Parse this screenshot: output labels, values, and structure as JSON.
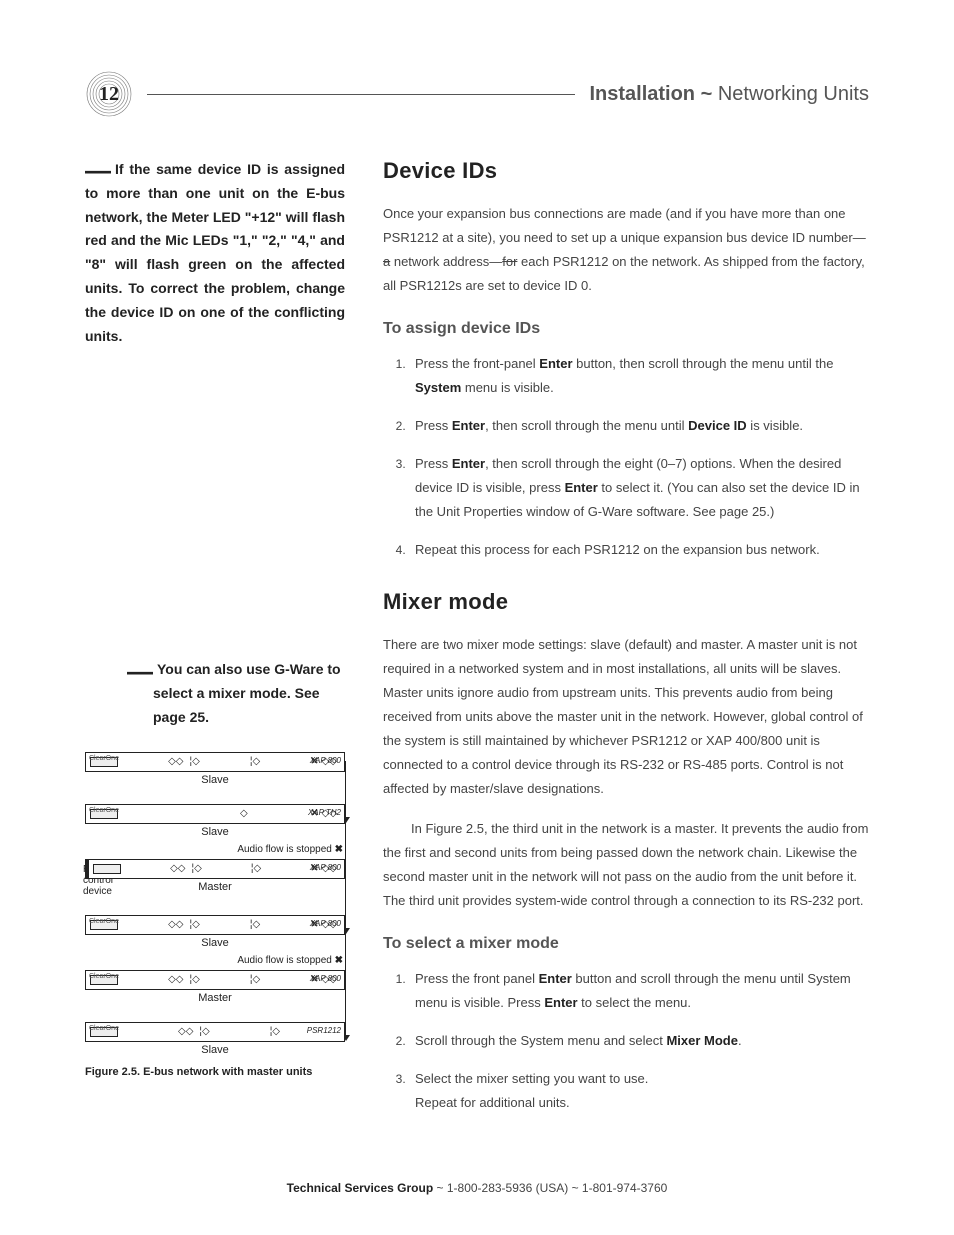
{
  "page_number": "12",
  "header": {
    "strong": "Installation",
    "sep": " ~ ",
    "light": "Networking Units"
  },
  "sidenote1": {
    "lead": "If the same device ID is assigned to more than one unit on the E-bus network, the Meter LED \"+12\" will flash red and the Mic LEDs \"1,\" \"2,\" \"4,\" and \"8\" will flash green on the affected units. To correct the problem, change the device ID on one of the conflicting units."
  },
  "sidenote2": {
    "text": "You can also use G-Ware to select a mixer mode. See page 25."
  },
  "figure": {
    "caption": "Figure 2.5. E-bus network with master units",
    "units": [
      "Slave",
      "Slave",
      "Master",
      "Slave",
      "Master",
      "Slave"
    ],
    "stop_msg": "Audio flow is stopped",
    "rs_label": "RS-232 control device",
    "last_brand": "PSR1212"
  },
  "main": {
    "h1a": "Device IDs",
    "p1_a": "Once your expansion bus connections are made (and if you have more than one PSR1212 at a site), you need to set up a unique expansion bus device ID number—",
    "p1_strike1": "a",
    "p1_b": " network address—",
    "p1_strike2": "for",
    "p1_c": " each PSR1212 on the network. As shipped from the factory, all PSR1212s are set to device ID 0.",
    "h2a": "To assign device IDs",
    "stepsA": [
      {
        "pre": "Press the front-panel ",
        "b1": "Enter",
        "mid": " button, then scroll through the menu until the ",
        "b2": "System",
        "post": " menu is visible."
      },
      {
        "pre": "Press ",
        "b1": "Enter",
        "mid": ", then scroll through the menu until ",
        "b2": "Device ID",
        "post": " is visible."
      },
      {
        "pre": "Press ",
        "b1": "Enter",
        "mid": ", then scroll through the eight (0–7) options. When the desired device ID is visible, press ",
        "b2": "Enter",
        "post": " to select it. (You can also set the device ID in the Unit Properties window of G-Ware software. See page 25.)"
      },
      {
        "pre": "Repeat this process for each PSR1212 on the expansion bus network.",
        "b1": "",
        "mid": "",
        "b2": "",
        "post": ""
      }
    ],
    "h1b": "Mixer mode",
    "p2": "There are two mixer mode settings: slave (default) and master. A master unit is not required in a networked system and in most installations, all units will be slaves. Master units ignore audio from upstream units. This prevents audio from being received from units above the master unit in the network. However, global control of the system is still maintained by whichever PSR1212 or XAP 400/800 unit is connected to a control device through its RS-232 or RS-485 ports. Control is not affected by master/slave designations.",
    "p3": "In Figure 2.5, the third unit in the network is a master. It prevents the audio from the first and second units from being passed down the network chain. Likewise the second master unit in the network will not pass on the audio from the unit before it. The third unit provides system-wide control through a connection to its RS-232 port.",
    "h2b": "To select a mixer mode",
    "stepsB": [
      {
        "pre": "Press the front panel ",
        "b1": "Enter",
        "mid": " button and scroll through the menu until System menu is visible. Press ",
        "b2": "Enter",
        "post": " to select the menu."
      },
      {
        "pre": "Scroll through the System menu and select ",
        "b1": "Mixer Mode",
        "mid": ".",
        "b2": "",
        "post": ""
      },
      {
        "pre": "Select the mixer setting you want to use.",
        "b1": "",
        "mid": "",
        "b2": "",
        "post": "",
        "extra": "Repeat for additional units."
      }
    ]
  },
  "footer": {
    "strong": "Technical Services Group",
    "rest": " ~ 1-800-283-5936 (USA) ~ 1-801-974-3760"
  }
}
